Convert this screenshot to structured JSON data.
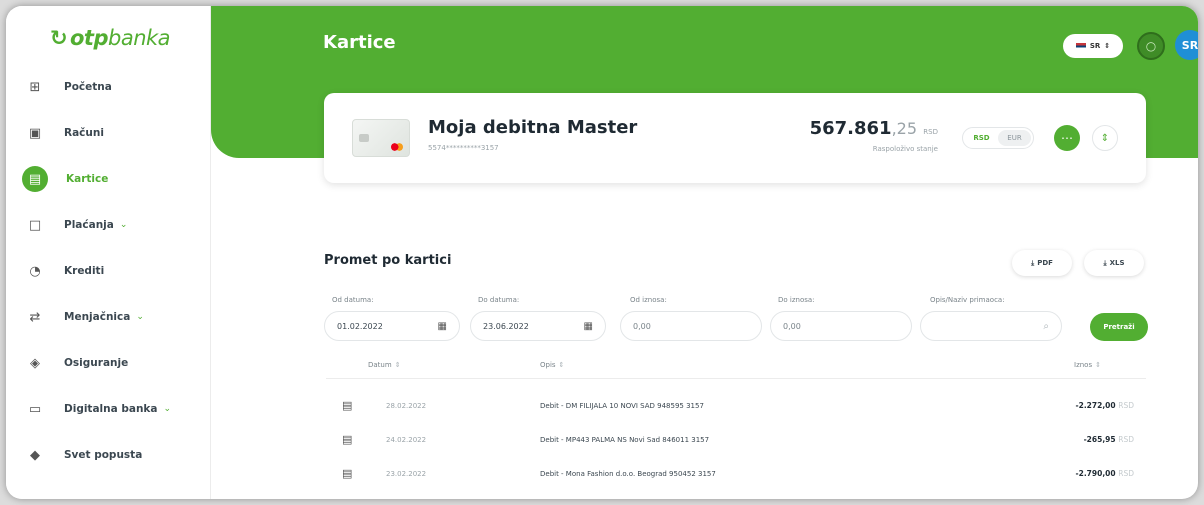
{
  "brand": {
    "logo_bold": "otp",
    "logo_light": "banka",
    "accent": "#52ae32"
  },
  "sidebar": {
    "items": [
      {
        "label": "Početna",
        "icon": "dashboard-icon"
      },
      {
        "label": "Računi",
        "icon": "accounts-icon"
      },
      {
        "label": "Kartice",
        "icon": "card-icon",
        "active": true
      },
      {
        "label": "Plaćanja",
        "icon": "payments-icon",
        "expandable": true
      },
      {
        "label": "Krediti",
        "icon": "loans-icon"
      },
      {
        "label": "Menjačnica",
        "icon": "exchange-icon",
        "expandable": true
      },
      {
        "label": "Osiguranje",
        "icon": "insurance-icon"
      },
      {
        "label": "Digitalna banka",
        "icon": "digital-bank-icon",
        "expandable": true
      },
      {
        "label": "Svet popusta",
        "icon": "discount-icon"
      }
    ]
  },
  "header": {
    "title": "Kartice",
    "language": "SR",
    "avatar": "SR"
  },
  "card": {
    "name": "Moja debitna Master",
    "number": "5574**********3157",
    "balance_int": "567.861",
    "balance_dec": ",25",
    "balance_currency": "RSD",
    "balance_label": "Raspoloživo stanje",
    "currency_active": "RSD",
    "currency_other": "EUR"
  },
  "transactions": {
    "title": "Promet po kartici",
    "pdf_label": "PDF",
    "xls_label": "XLS",
    "filters": {
      "from_date_label": "Od datuma:",
      "from_date_value": "01.02.2022",
      "to_date_label": "Do datuma:",
      "to_date_value": "23.06.2022",
      "from_amount_label": "Od iznosa:",
      "from_amount_value": "0,00",
      "to_amount_label": "Do iznosa:",
      "to_amount_value": "0,00",
      "desc_label": "Opis/Naziv primaoca:",
      "search_label": "Pretraži"
    },
    "columns": {
      "date": "Datum",
      "desc": "Opis",
      "amount": "Iznos"
    },
    "rows": [
      {
        "date": "28.02.2022",
        "desc": "Debit - DM FILIJALA 10 NOVI SAD 948595 3157",
        "amount": "-2.272,00",
        "currency": "RSD"
      },
      {
        "date": "24.02.2022",
        "desc": "Debit - MP443 PALMA NS Novi Sad 846011 3157",
        "amount": "-265,95",
        "currency": "RSD"
      },
      {
        "date": "23.02.2022",
        "desc": "Debit - Mona Fashion d.o.o. Beograd 950452 3157",
        "amount": "-2.790,00",
        "currency": "RSD"
      }
    ]
  }
}
